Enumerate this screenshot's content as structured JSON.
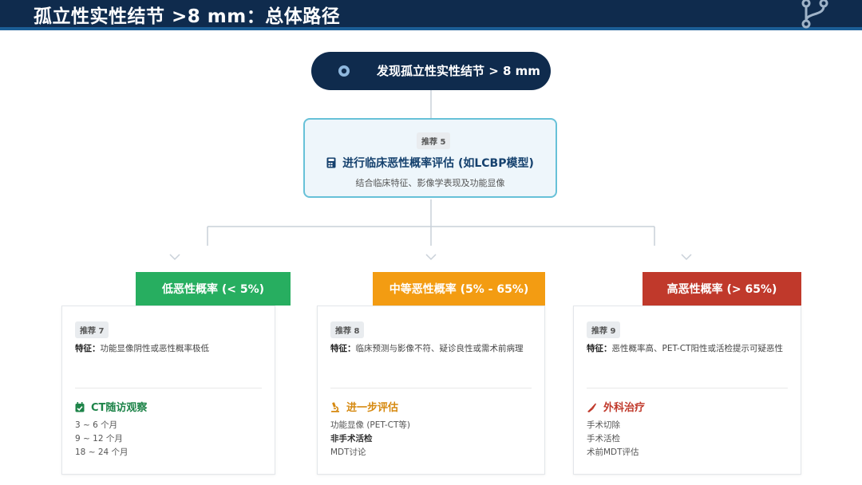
{
  "header": {
    "title": "孤立性实性结节 >8 mm：总体路径"
  },
  "start": {
    "label": "发现孤立性实性结节 > 8 mm"
  },
  "evaluation": {
    "tag": "推荐 5",
    "title": "进行临床恶性概率评估 (如LCBP模型)",
    "subtitle": "结合临床特征、影像学表现及功能显像"
  },
  "branches": [
    {
      "header": "低恶性概率 (< 5%)",
      "color": "#27ae60",
      "tag": "推荐 7",
      "feature_label": "特征：",
      "feature_text": "功能显像阴性或恶性概率极低",
      "action_title": "CT随访观察",
      "action_color": "#1e8449",
      "items": [
        "3 ~ 6 个月",
        "9 ~ 12 个月",
        "18 ~ 24 个月"
      ]
    },
    {
      "header": "中等恶性概率 (5% - 65%)",
      "color": "#f39c12",
      "tag": "推荐 8",
      "feature_label": "特征：",
      "feature_text": "临床预测与影像不符、疑诊良性或需术前病理",
      "action_title": "进一步评估",
      "action_color": "#d68910",
      "items": [
        "功能显像 (PET-CT等)",
        "非手术活检",
        "MDT讨论"
      ]
    },
    {
      "header": "高恶性概率 (> 65%)",
      "color": "#c0392b",
      "tag": "推荐 9",
      "feature_label": "特征：",
      "feature_text": "恶性概率高、PET-CT阳性或活检提示可疑恶性",
      "action_title": "外科治疗",
      "action_color": "#c0392b",
      "items": [
        "手术切除",
        "手术活检",
        "术前MDT评估"
      ]
    }
  ]
}
